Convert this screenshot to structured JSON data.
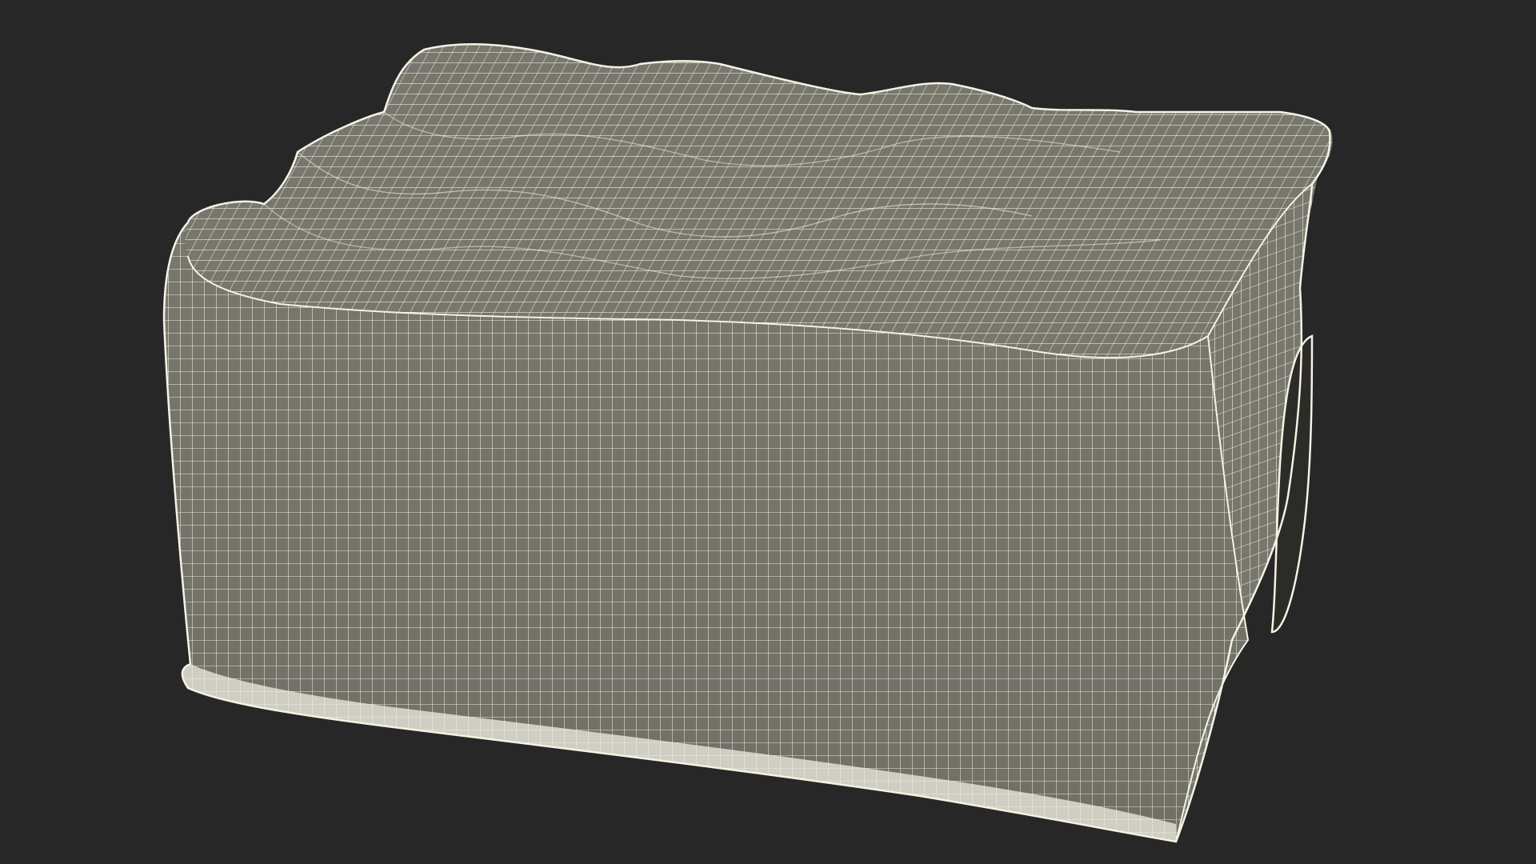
{
  "scene": {
    "background_color": "#272727",
    "surface_color": "#77776d",
    "wire_color": "#f4f2e4",
    "handle_cavity_color": "#2b2b28",
    "object": "shrink-wrapped-bottle-pack-wireframe"
  }
}
